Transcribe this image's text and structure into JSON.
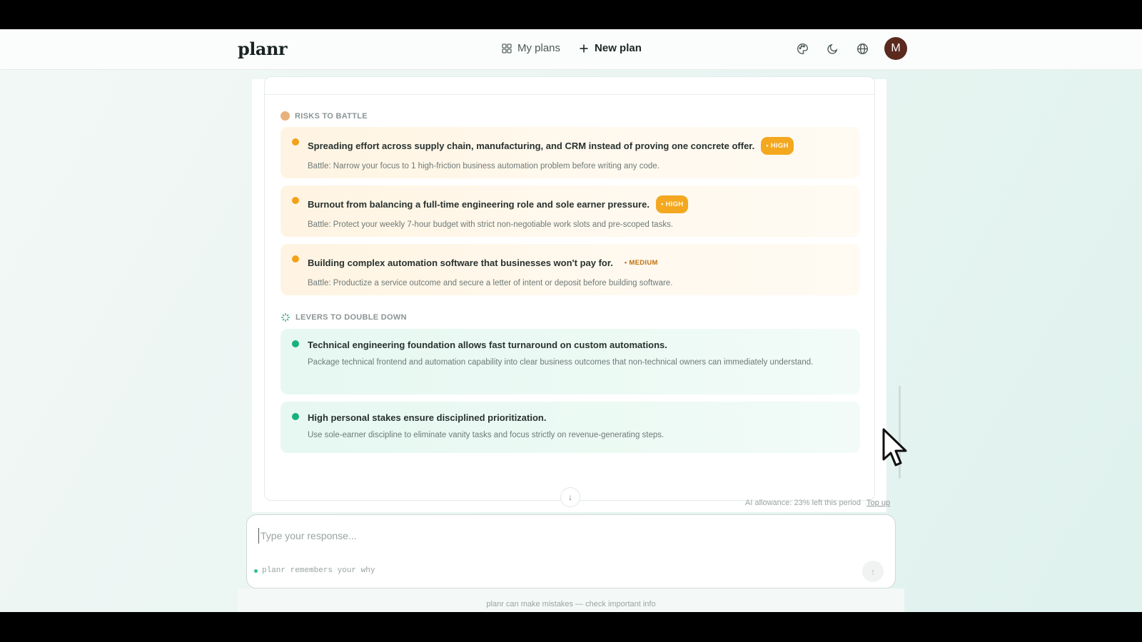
{
  "app": {
    "logo": "planr"
  },
  "nav": {
    "my_plans": "My plans",
    "new_plan": "New plan"
  },
  "header_icons": [
    "palette-icon",
    "moon-icon",
    "globe-icon"
  ],
  "user": {
    "avatar_initial": "M"
  },
  "risks": {
    "label": "RISKS TO BATTLE",
    "items": [
      {
        "title": "Spreading effort across supply chain, manufacturing, and CRM instead of proving one concrete offer.",
        "badge": "• HIGH",
        "desc": "Battle: Narrow your focus to 1 high-friction business automation problem before writing any code."
      },
      {
        "title": "Burnout from balancing a full-time engineering role and sole earner pressure.",
        "badge": "• HIGH",
        "desc": "Battle: Protect your weekly 7-hour budget with strict non-negotiable work slots and pre-scoped tasks."
      },
      {
        "title": "Building complex automation software that businesses won't pay for.",
        "badge": "• MEDIUM",
        "desc": "Battle: Productize a service outcome and secure a letter of intent or deposit before building software."
      }
    ]
  },
  "levers": {
    "label": "LEVERS TO DOUBLE DOWN",
    "items": [
      {
        "title": "Technical engineering foundation allows fast turnaround on custom automations.",
        "desc": "Package technical frontend and automation capability into clear business outcomes that non-technical owners can immediately understand."
      },
      {
        "title": "High personal stakes ensure disciplined prioritization.",
        "desc": "Use sole-earner discipline to eliminate vanity tasks and focus strictly on revenue-generating steps."
      }
    ]
  },
  "allowance": {
    "text": "AI allowance: 23% left this period",
    "topup": "Top up"
  },
  "composer": {
    "placeholder": "Type your response...",
    "note": "planr remembers your why"
  },
  "disclaimer": "planr can make mistakes — check important info",
  "colors": {
    "high_badge": "#f3a81f",
    "risk_bullet": "#f2a11a",
    "lever_bullet": "#19b07d",
    "avatar": "#5a2a1e"
  }
}
